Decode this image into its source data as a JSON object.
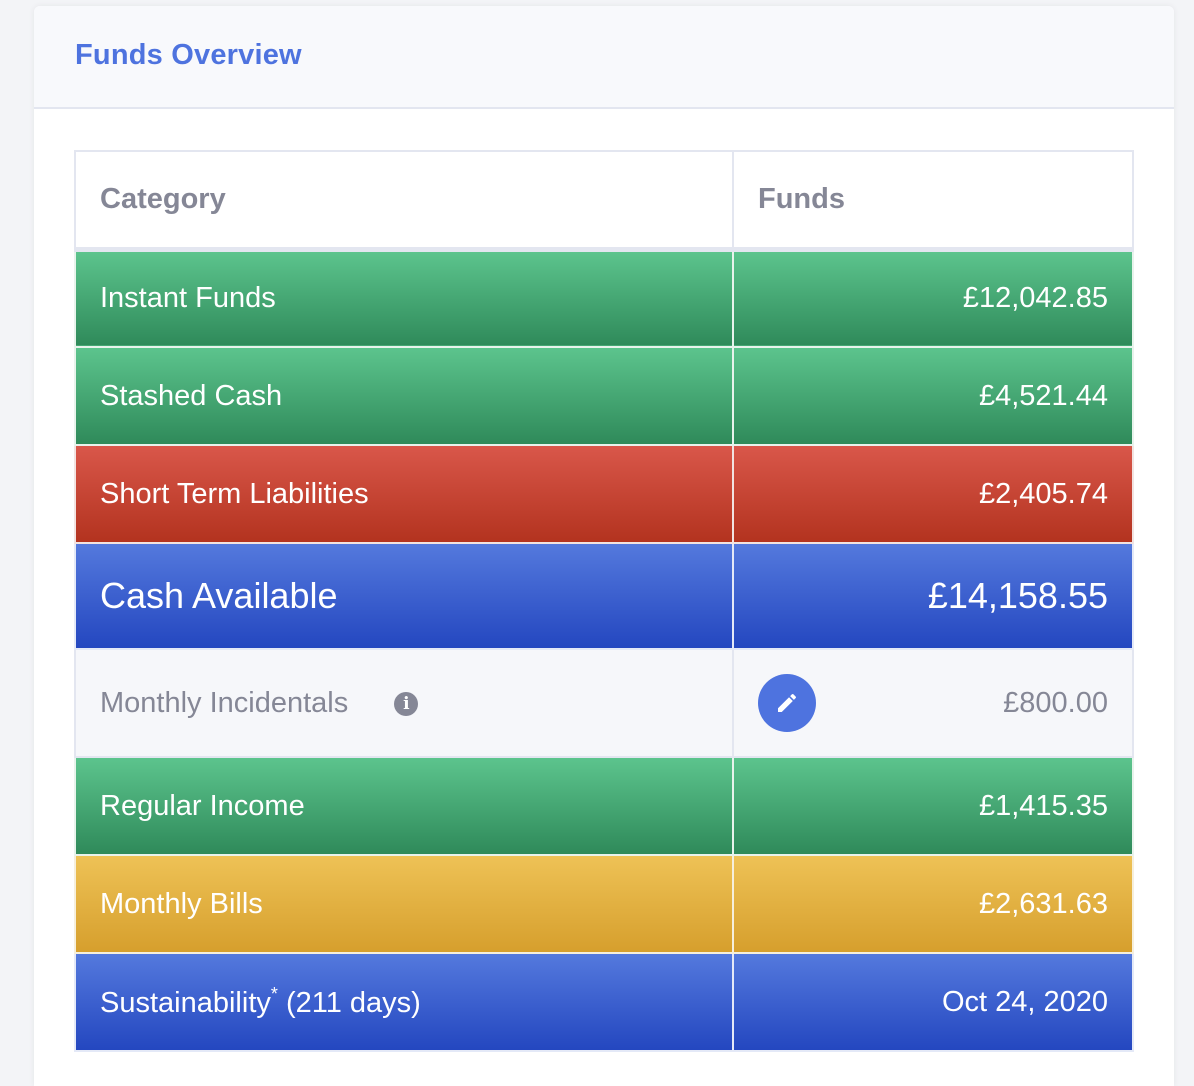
{
  "card": {
    "title": "Funds Overview"
  },
  "table": {
    "headers": {
      "category": "Category",
      "funds": "Funds"
    },
    "rows": [
      {
        "category": "Instant Funds",
        "funds": "£12,042.85",
        "color": "#4caf78"
      },
      {
        "category": "Stashed Cash",
        "funds": "£4,521.44",
        "color": "#4caf78"
      },
      {
        "category": "Short Term Liabilities",
        "funds": "£2,405.74",
        "color": "#c9432f"
      },
      {
        "category": "Cash Available",
        "funds": "£14,158.55",
        "color": "#3b5fd0"
      },
      {
        "category": "Monthly Incidentals",
        "funds": "£800.00",
        "info_icon": "info-icon",
        "edit_icon": "pencil-icon"
      },
      {
        "category": "Regular Income",
        "funds": "£1,415.35",
        "color": "#4caf78"
      },
      {
        "category": "Monthly Bills",
        "funds": "£2,631.63",
        "color": "#e2b040"
      },
      {
        "category": "Sustainability",
        "category_sup": "*",
        "category_suffix": "(211 days)",
        "funds": "Oct 24, 2020",
        "color": "#3b5fd0"
      }
    ]
  }
}
